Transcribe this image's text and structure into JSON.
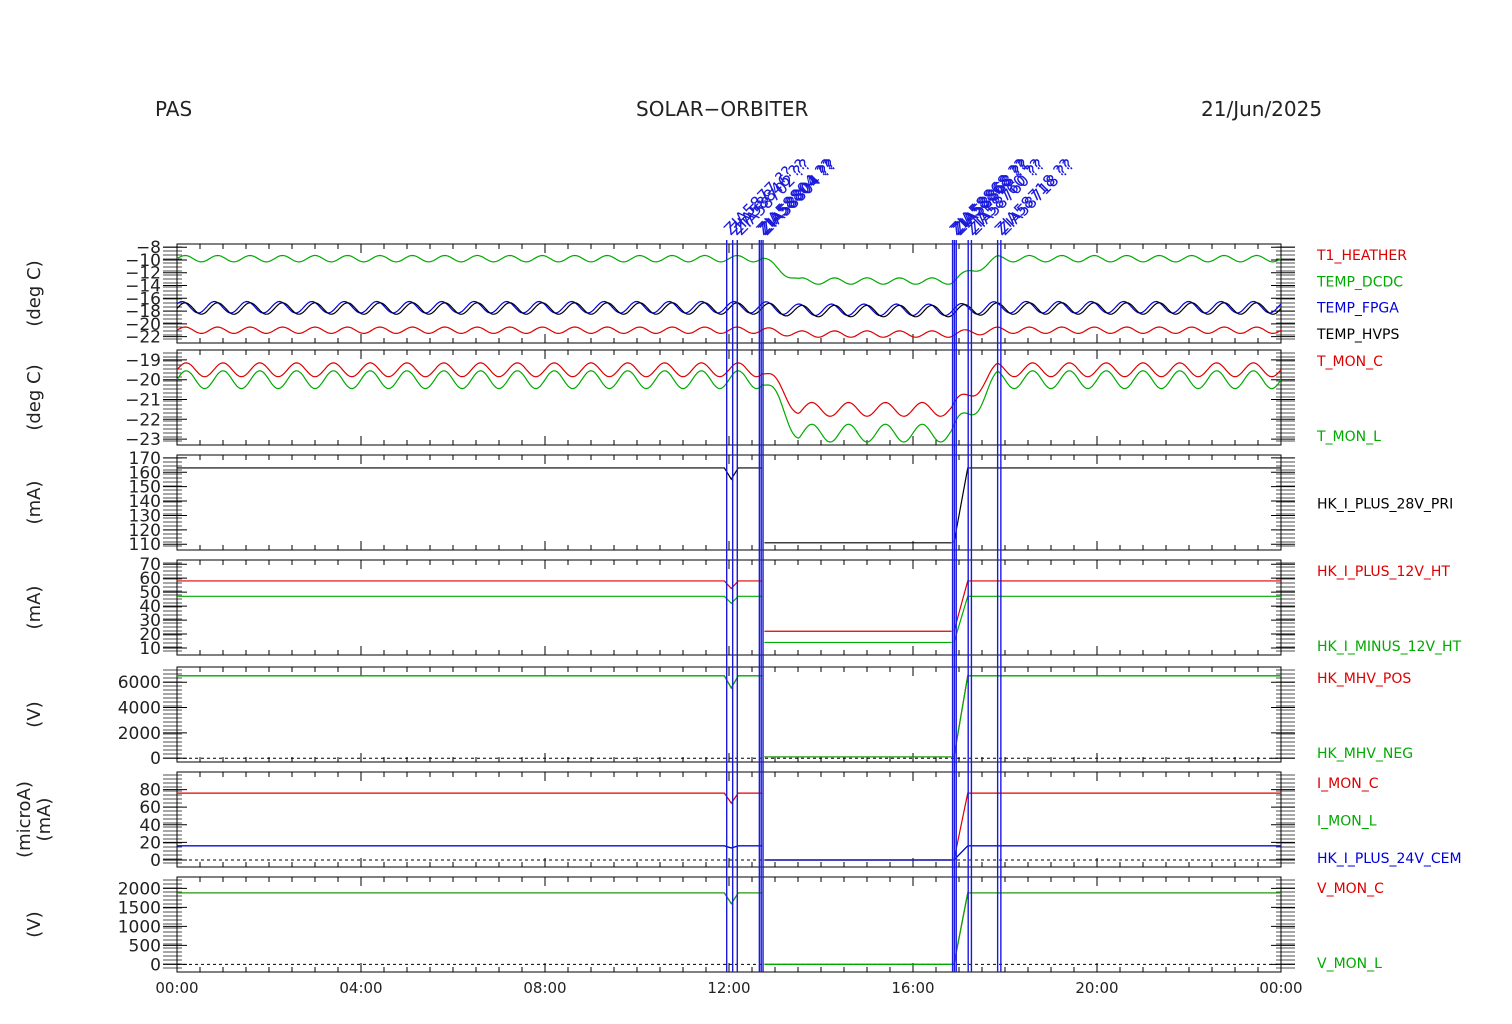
{
  "header": {
    "left": "PAS",
    "center": "SOLAR−ORBITER",
    "right": "21/Jun/2025"
  },
  "colors": {
    "black": "#000000",
    "red": "#dd0000",
    "green": "#00aa00",
    "blue": "#0000dd",
    "event": "#1a1adc"
  },
  "time_axis": {
    "min_hours": 0,
    "max_hours": 24,
    "ticks": [
      {
        "h": 0,
        "label": "00:00"
      },
      {
        "h": 4,
        "label": "04:00"
      },
      {
        "h": 8,
        "label": "08:00"
      },
      {
        "h": 12,
        "label": "12:00"
      },
      {
        "h": 16,
        "label": "16:00"
      },
      {
        "h": 20,
        "label": "20:00"
      },
      {
        "h": 24,
        "label": "00:00"
      }
    ],
    "minor_step_hours": 0.5
  },
  "events": [
    {
      "h": 11.95,
      "label": "ZIA5877 ??"
    },
    {
      "h": 12.08,
      "label": "ZIA58846 ??"
    },
    {
      "h": 12.18,
      "label": "ZIA58702 ??"
    },
    {
      "h": 12.66,
      "label": "ZIA58804 ??"
    },
    {
      "h": 12.7,
      "label": "ZIA58804 ??"
    },
    {
      "h": 12.74,
      "label": "ZIA58804 ??"
    },
    {
      "h": 16.86,
      "label": "ZIA58868 ??"
    },
    {
      "h": 16.9,
      "label": "ZIA58868 ??"
    },
    {
      "h": 16.94,
      "label": "ZIA58868 ??"
    },
    {
      "h": 17.2,
      "label": "ZIA58760 ??"
    },
    {
      "h": 17.27,
      "label": "ZIA58760 ??"
    },
    {
      "h": 17.84,
      "label": "ZIA58718 ??"
    },
    {
      "h": 17.91,
      "label": "ZIA58718 ??"
    }
  ],
  "chart_data": [
    {
      "type": "line",
      "panel": "temps",
      "ylabel": "(deg C)",
      "ylim": [
        -23,
        -7.5
      ],
      "yticks": [
        -8,
        -10,
        -12,
        -14,
        -16,
        -18,
        -20,
        -22
      ],
      "ytick_labels": [
        "−8",
        "−10",
        "−12",
        "−14",
        "−16",
        "−18",
        "−20",
        "−22"
      ],
      "series": [
        {
          "name": "T1_HEATHER",
          "color": "#dd0000",
          "shape": "osc",
          "base": [
            -21.0,
            -21.6,
            -21.0
          ],
          "amp": 0.5,
          "cycles": 34
        },
        {
          "name": "TEMP_DCDC",
          "color": "#00aa00",
          "shape": "osc",
          "base": [
            -9.8,
            -13.3,
            -9.8
          ],
          "amp": 0.5,
          "cycles": 34
        },
        {
          "name": "TEMP_FPGA",
          "color": "#0000dd",
          "shape": "osc",
          "base": [
            -17.4,
            -17.8,
            -17.4
          ],
          "amp": 0.9,
          "cycles": 34,
          "phase": 0.6
        },
        {
          "name": "TEMP_HVPS",
          "color": "#000000",
          "shape": "osc",
          "base": [
            -17.6,
            -18.0,
            -17.6
          ],
          "amp": 0.9,
          "cycles": 34
        }
      ]
    },
    {
      "type": "line",
      "panel": "monitor_temps",
      "ylabel": "(deg C)",
      "ylim": [
        -23.3,
        -18.5
      ],
      "yticks": [
        -19,
        -20,
        -21,
        -22,
        -23
      ],
      "ytick_labels": [
        "−19",
        "−20",
        "−21",
        "−22",
        "−23"
      ],
      "series": [
        {
          "name": "T_MON_C",
          "color": "#dd0000",
          "shape": "osc",
          "base": [
            -19.5,
            -21.5,
            -19.5
          ],
          "amp": 0.35,
          "cycles": 30
        },
        {
          "name": "T_MON_L",
          "color": "#00aa00",
          "shape": "osc",
          "base": [
            -20.0,
            -22.7,
            -20.0
          ],
          "amp": 0.45,
          "cycles": 30
        }
      ]
    },
    {
      "type": "line",
      "panel": "i_28v",
      "ylabel": "(mA)",
      "ylim": [
        106,
        172
      ],
      "yticks": [
        110,
        120,
        130,
        140,
        150,
        160,
        170
      ],
      "ytick_labels": [
        "110",
        "120",
        "130",
        "140",
        "150",
        "160",
        "170"
      ],
      "series": [
        {
          "name": "HK_I_PLUS_28V_PRI",
          "color": "#000000",
          "shape": "step",
          "on": 163,
          "off": 111
        }
      ]
    },
    {
      "type": "line",
      "panel": "i_12v",
      "ylabel": "(mA)",
      "ylim": [
        5,
        73
      ],
      "yticks": [
        10,
        20,
        30,
        40,
        50,
        60,
        70
      ],
      "ytick_labels": [
        "10",
        "20",
        "30",
        "40",
        "50",
        "60",
        "70"
      ],
      "series": [
        {
          "name": "HK_I_PLUS_12V_HT",
          "color": "#dd0000",
          "shape": "step",
          "on": 58,
          "off": 22
        },
        {
          "name": "HK_I_MINUS_12V_HT",
          "color": "#00aa00",
          "shape": "step",
          "on": 47,
          "off": 14
        }
      ]
    },
    {
      "type": "line",
      "panel": "mhv",
      "ylabel": "(V)",
      "ylim": [
        -300,
        7200
      ],
      "yticks": [
        0,
        2000,
        4000,
        6000
      ],
      "ytick_labels": [
        "0",
        "2000",
        "4000",
        "6000"
      ],
      "series": [
        {
          "name": "HK_MHV_POS",
          "color": "#dd0000",
          "shape": "step",
          "on": 6500,
          "off": 100
        },
        {
          "name": "HK_MHV_NEG",
          "color": "#00aa00",
          "shape": "step",
          "on": 6500,
          "off": 100
        }
      ]
    },
    {
      "type": "line",
      "panel": "i_mon",
      "ylabel": "(microA)\n(mA)",
      "ylim": [
        -8,
        100
      ],
      "yticks": [
        0,
        20,
        40,
        60,
        80
      ],
      "ytick_labels": [
        "0",
        "20",
        "40",
        "60",
        "80"
      ],
      "series": [
        {
          "name": "I_MON_C",
          "color": "#dd0000",
          "shape": "step",
          "on": 76,
          "off": 0
        },
        {
          "name": "I_MON_L",
          "color": "#00aa00",
          "shape": "step",
          "on": 16,
          "off": 0
        },
        {
          "name": "HK_I_PLUS_24V_CEM",
          "color": "#0000dd",
          "shape": "step",
          "on": 16,
          "off": 0
        }
      ]
    },
    {
      "type": "line",
      "panel": "v_mon",
      "ylabel": "(V)",
      "ylim": [
        -200,
        2300
      ],
      "yticks": [
        0,
        500,
        1000,
        1500,
        2000
      ],
      "ytick_labels": [
        "0",
        "500",
        "1000",
        "1500",
        "2000"
      ],
      "series": [
        {
          "name": "V_MON_C",
          "color": "#dd0000",
          "shape": "step",
          "on": 1880,
          "off": 0
        },
        {
          "name": "V_MON_L",
          "color": "#00aa00",
          "shape": "step",
          "on": 1880,
          "off": 0
        }
      ]
    }
  ],
  "hv_off_window_hours": [
    12.72,
    16.84
  ]
}
